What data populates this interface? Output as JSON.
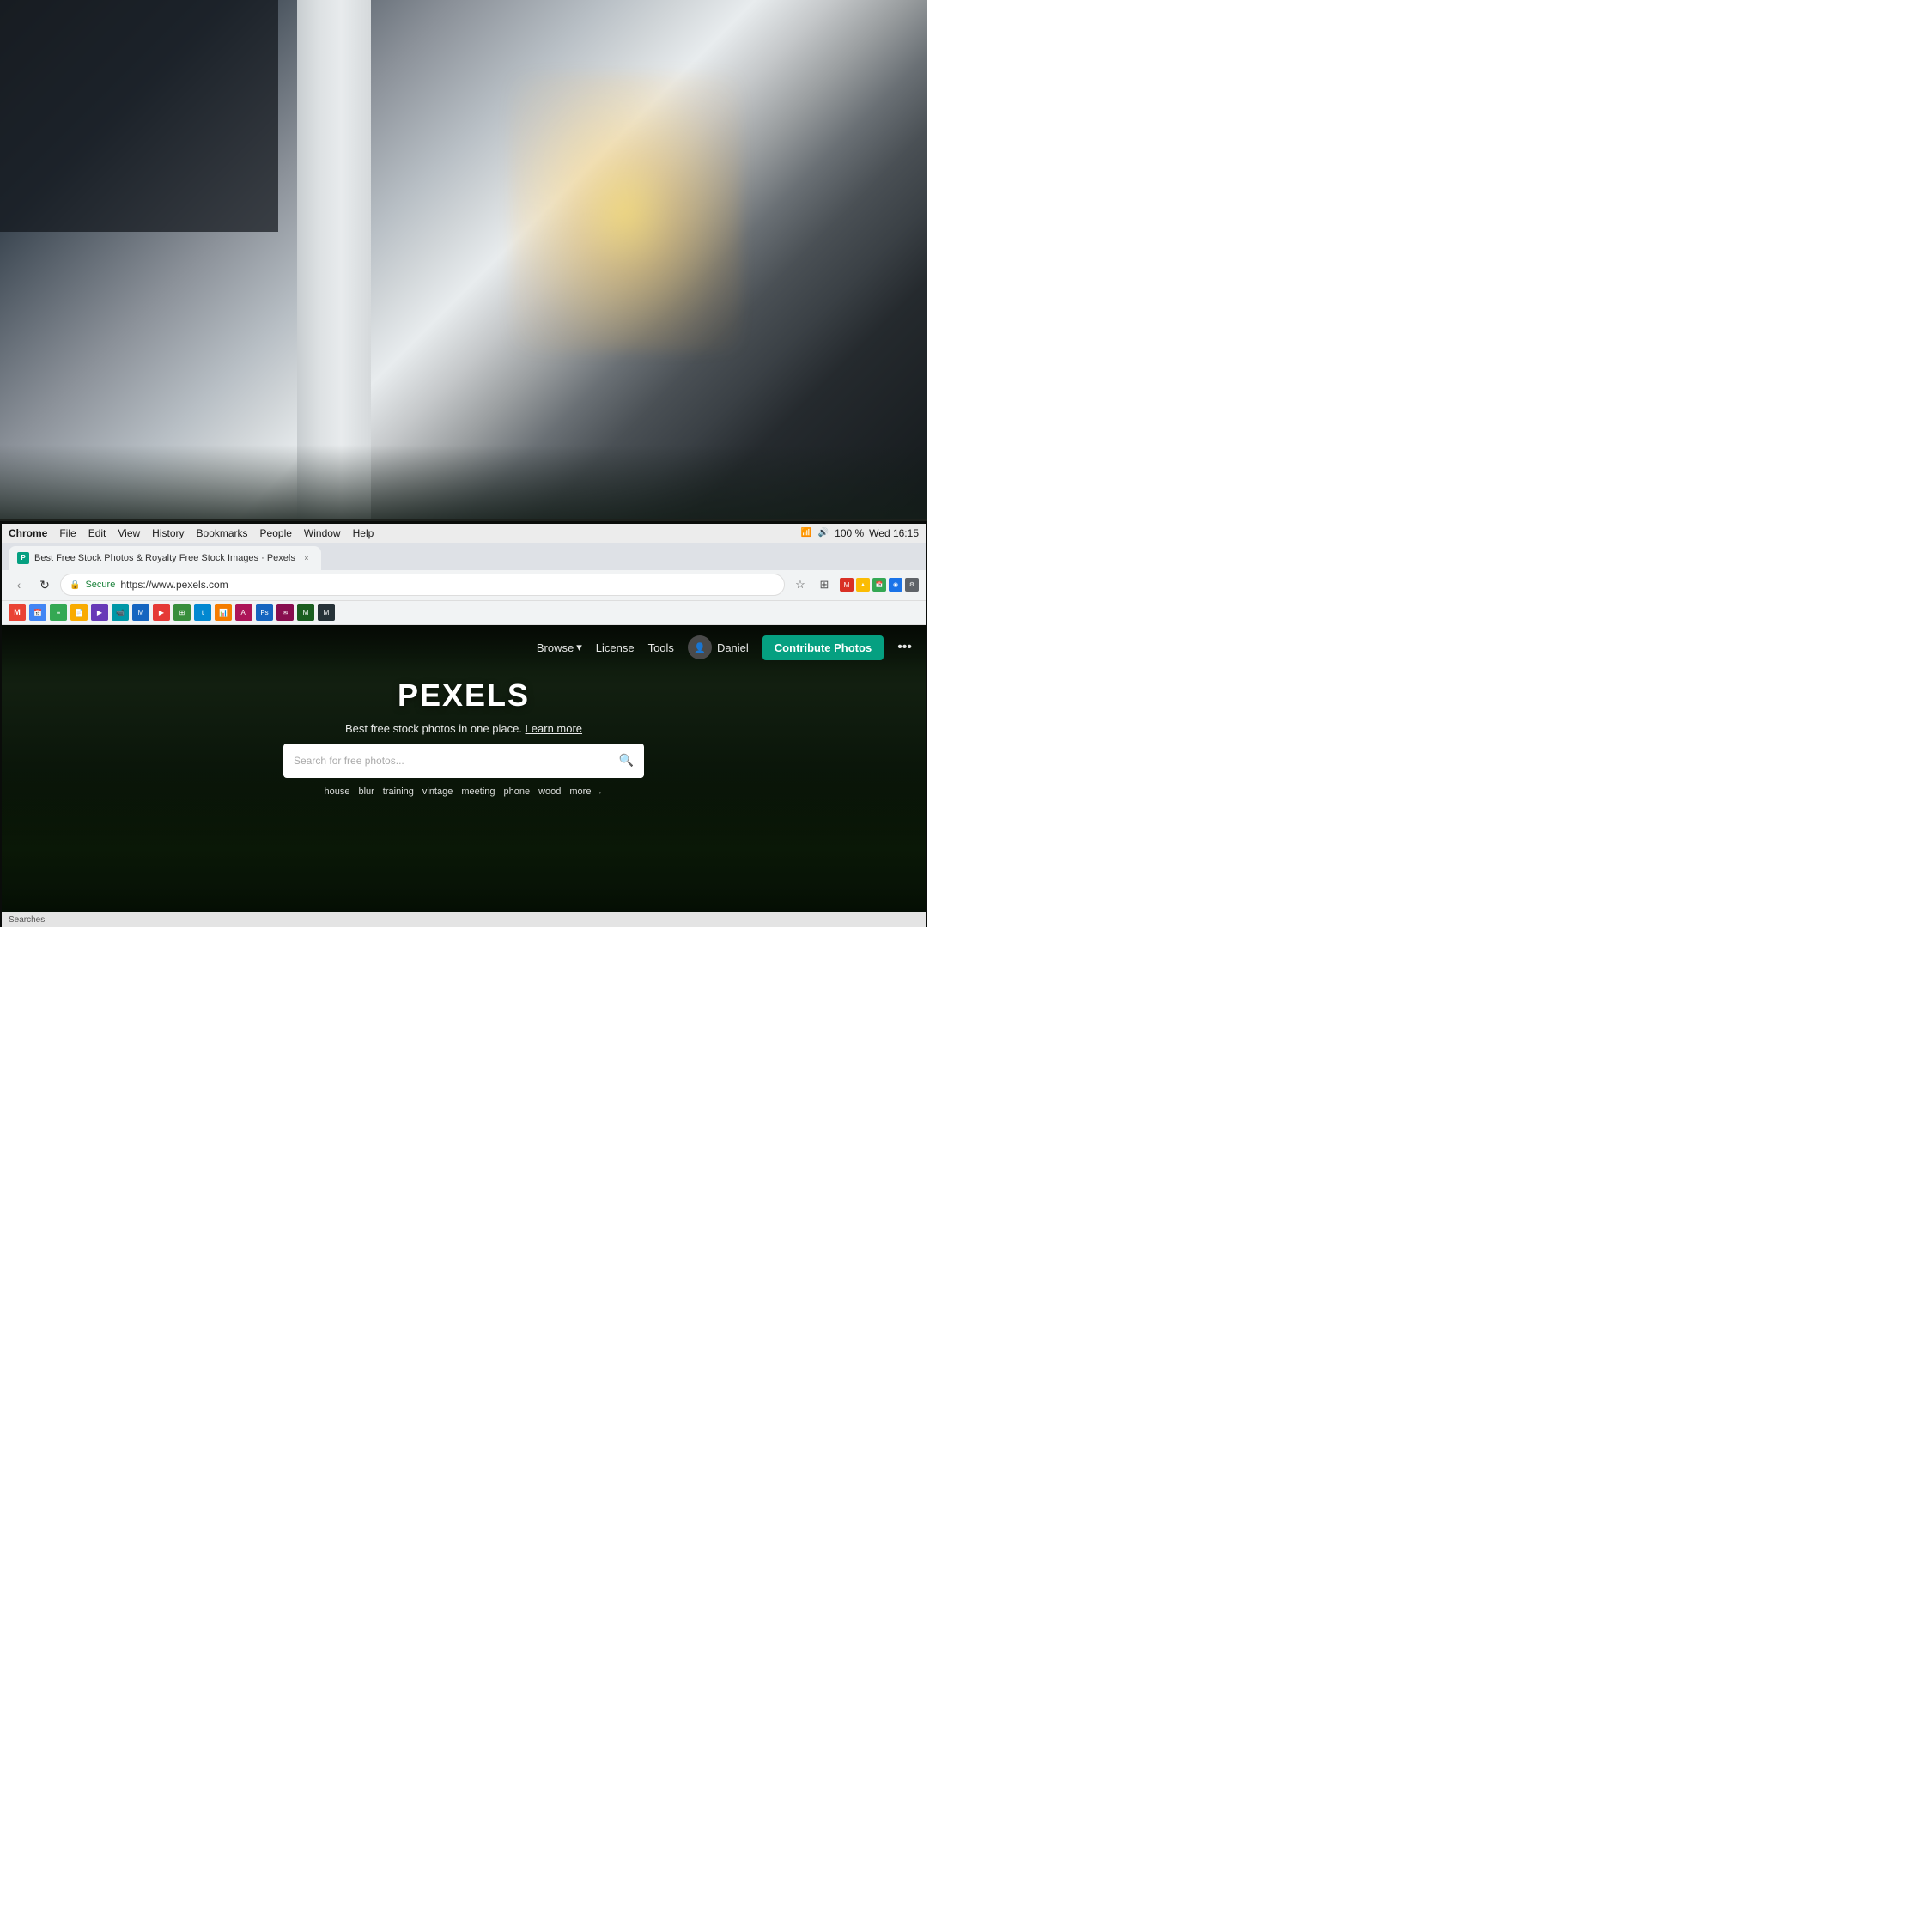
{
  "background": {
    "description": "Office environment with blurred background, monitor in foreground"
  },
  "menubar": {
    "app_name": "Chrome",
    "menu_items": [
      "File",
      "Edit",
      "View",
      "History",
      "Bookmarks",
      "People",
      "Window",
      "Help"
    ],
    "time": "Wed 16:15",
    "battery": "100 %"
  },
  "browser": {
    "tab": {
      "favicon_text": "P",
      "title": "Best Free Stock Photos & Royalty Free Stock Images · Pexels",
      "close_label": "×"
    },
    "address_bar": {
      "secure_label": "Secure",
      "url": "https://www.pexels.com",
      "secure_icon": "🔒"
    },
    "nav": {
      "back_icon": "‹",
      "reload_icon": "↻"
    }
  },
  "pexels": {
    "nav": {
      "browse_label": "Browse",
      "browse_arrow": "▾",
      "license_label": "License",
      "tools_label": "Tools",
      "user_name": "Daniel",
      "contribute_label": "Contribute Photos",
      "more_icon": "•••"
    },
    "hero": {
      "logo": "PEXELS",
      "tagline": "Best free stock photos in one place.",
      "learn_more": "Learn more",
      "search_placeholder": "Search for free photos...",
      "search_icon": "🔍"
    },
    "search_tags": [
      {
        "label": "house"
      },
      {
        "label": "blur"
      },
      {
        "label": "training"
      },
      {
        "label": "vintage"
      },
      {
        "label": "meeting"
      },
      {
        "label": "phone"
      },
      {
        "label": "wood"
      },
      {
        "label": "more →"
      }
    ]
  },
  "statusbar": {
    "text": "Searches"
  },
  "colors": {
    "contribute_btn_bg": "#05a081",
    "contribute_btn_text": "#ffffff",
    "pexels_logo_color": "#ffffff",
    "search_bg": "#ffffff",
    "nav_text": "rgba(255,255,255,0.9)",
    "tag_text": "rgba(255,255,255,0.85)"
  }
}
